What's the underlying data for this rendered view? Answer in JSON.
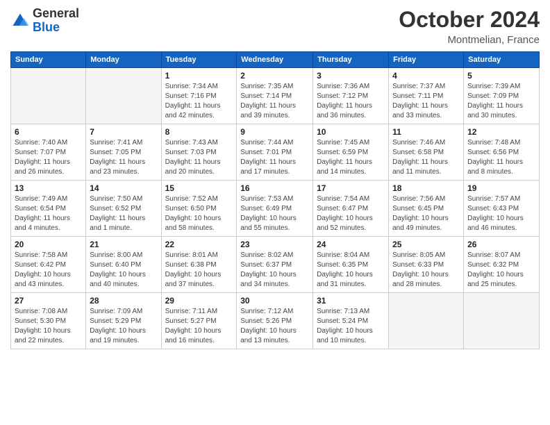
{
  "header": {
    "logo_general": "General",
    "logo_blue": "Blue",
    "month": "October 2024",
    "location": "Montmelian, France"
  },
  "days_of_week": [
    "Sunday",
    "Monday",
    "Tuesday",
    "Wednesday",
    "Thursday",
    "Friday",
    "Saturday"
  ],
  "weeks": [
    [
      {
        "day": "",
        "info": ""
      },
      {
        "day": "",
        "info": ""
      },
      {
        "day": "1",
        "info": "Sunrise: 7:34 AM\nSunset: 7:16 PM\nDaylight: 11 hours and 42 minutes."
      },
      {
        "day": "2",
        "info": "Sunrise: 7:35 AM\nSunset: 7:14 PM\nDaylight: 11 hours and 39 minutes."
      },
      {
        "day": "3",
        "info": "Sunrise: 7:36 AM\nSunset: 7:12 PM\nDaylight: 11 hours and 36 minutes."
      },
      {
        "day": "4",
        "info": "Sunrise: 7:37 AM\nSunset: 7:11 PM\nDaylight: 11 hours and 33 minutes."
      },
      {
        "day": "5",
        "info": "Sunrise: 7:39 AM\nSunset: 7:09 PM\nDaylight: 11 hours and 30 minutes."
      }
    ],
    [
      {
        "day": "6",
        "info": "Sunrise: 7:40 AM\nSunset: 7:07 PM\nDaylight: 11 hours and 26 minutes."
      },
      {
        "day": "7",
        "info": "Sunrise: 7:41 AM\nSunset: 7:05 PM\nDaylight: 11 hours and 23 minutes."
      },
      {
        "day": "8",
        "info": "Sunrise: 7:43 AM\nSunset: 7:03 PM\nDaylight: 11 hours and 20 minutes."
      },
      {
        "day": "9",
        "info": "Sunrise: 7:44 AM\nSunset: 7:01 PM\nDaylight: 11 hours and 17 minutes."
      },
      {
        "day": "10",
        "info": "Sunrise: 7:45 AM\nSunset: 6:59 PM\nDaylight: 11 hours and 14 minutes."
      },
      {
        "day": "11",
        "info": "Sunrise: 7:46 AM\nSunset: 6:58 PM\nDaylight: 11 hours and 11 minutes."
      },
      {
        "day": "12",
        "info": "Sunrise: 7:48 AM\nSunset: 6:56 PM\nDaylight: 11 hours and 8 minutes."
      }
    ],
    [
      {
        "day": "13",
        "info": "Sunrise: 7:49 AM\nSunset: 6:54 PM\nDaylight: 11 hours and 4 minutes."
      },
      {
        "day": "14",
        "info": "Sunrise: 7:50 AM\nSunset: 6:52 PM\nDaylight: 11 hours and 1 minute."
      },
      {
        "day": "15",
        "info": "Sunrise: 7:52 AM\nSunset: 6:50 PM\nDaylight: 10 hours and 58 minutes."
      },
      {
        "day": "16",
        "info": "Sunrise: 7:53 AM\nSunset: 6:49 PM\nDaylight: 10 hours and 55 minutes."
      },
      {
        "day": "17",
        "info": "Sunrise: 7:54 AM\nSunset: 6:47 PM\nDaylight: 10 hours and 52 minutes."
      },
      {
        "day": "18",
        "info": "Sunrise: 7:56 AM\nSunset: 6:45 PM\nDaylight: 10 hours and 49 minutes."
      },
      {
        "day": "19",
        "info": "Sunrise: 7:57 AM\nSunset: 6:43 PM\nDaylight: 10 hours and 46 minutes."
      }
    ],
    [
      {
        "day": "20",
        "info": "Sunrise: 7:58 AM\nSunset: 6:42 PM\nDaylight: 10 hours and 43 minutes."
      },
      {
        "day": "21",
        "info": "Sunrise: 8:00 AM\nSunset: 6:40 PM\nDaylight: 10 hours and 40 minutes."
      },
      {
        "day": "22",
        "info": "Sunrise: 8:01 AM\nSunset: 6:38 PM\nDaylight: 10 hours and 37 minutes."
      },
      {
        "day": "23",
        "info": "Sunrise: 8:02 AM\nSunset: 6:37 PM\nDaylight: 10 hours and 34 minutes."
      },
      {
        "day": "24",
        "info": "Sunrise: 8:04 AM\nSunset: 6:35 PM\nDaylight: 10 hours and 31 minutes."
      },
      {
        "day": "25",
        "info": "Sunrise: 8:05 AM\nSunset: 6:33 PM\nDaylight: 10 hours and 28 minutes."
      },
      {
        "day": "26",
        "info": "Sunrise: 8:07 AM\nSunset: 6:32 PM\nDaylight: 10 hours and 25 minutes."
      }
    ],
    [
      {
        "day": "27",
        "info": "Sunrise: 7:08 AM\nSunset: 5:30 PM\nDaylight: 10 hours and 22 minutes."
      },
      {
        "day": "28",
        "info": "Sunrise: 7:09 AM\nSunset: 5:29 PM\nDaylight: 10 hours and 19 minutes."
      },
      {
        "day": "29",
        "info": "Sunrise: 7:11 AM\nSunset: 5:27 PM\nDaylight: 10 hours and 16 minutes."
      },
      {
        "day": "30",
        "info": "Sunrise: 7:12 AM\nSunset: 5:26 PM\nDaylight: 10 hours and 13 minutes."
      },
      {
        "day": "31",
        "info": "Sunrise: 7:13 AM\nSunset: 5:24 PM\nDaylight: 10 hours and 10 minutes."
      },
      {
        "day": "",
        "info": ""
      },
      {
        "day": "",
        "info": ""
      }
    ]
  ]
}
